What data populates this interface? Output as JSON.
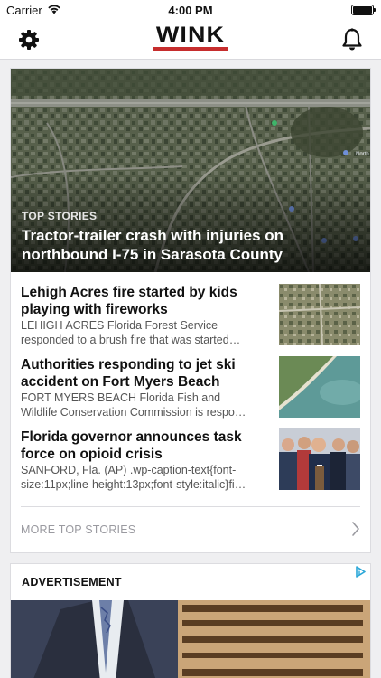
{
  "status_bar": {
    "carrier": "Carrier",
    "time": "4:00 PM"
  },
  "header": {
    "logo_text": "WINK",
    "brand_color": "#c62d2d"
  },
  "hero": {
    "kicker": "TOP STORIES",
    "headline": "Tractor-trailer crash with injuries on northbound I-75 in Sarasota County",
    "map_labels": [
      "North"
    ]
  },
  "stories": [
    {
      "title": "Lehigh Acres fire started by kids playing with fireworks",
      "summary_lines": [
        "LEHIGH ACRES Florida Forest Service",
        "responded to a brush fire that was started…"
      ]
    },
    {
      "title": "Authorities responding to jet ski accident on Fort Myers Beach",
      "summary_lines": [
        "FORT MYERS BEACH Florida Fish and",
        "Wildlife Conservation Commission is respo…"
      ]
    },
    {
      "title": "Florida governor announces task force on opioid crisis",
      "summary_lines": [
        "SANFORD, Fla. (AP) .wp-caption-text{font-",
        "size:11px;line-height:13px;font-style:italic}fi…"
      ]
    }
  ],
  "more_link": "MORE TOP STORIES",
  "ad": {
    "label": "ADVERTISEMENT"
  },
  "icons": [
    "wifi-icon",
    "battery-icon",
    "gear-icon",
    "bell-icon",
    "chevron-right-icon",
    "adchoices-icon"
  ]
}
